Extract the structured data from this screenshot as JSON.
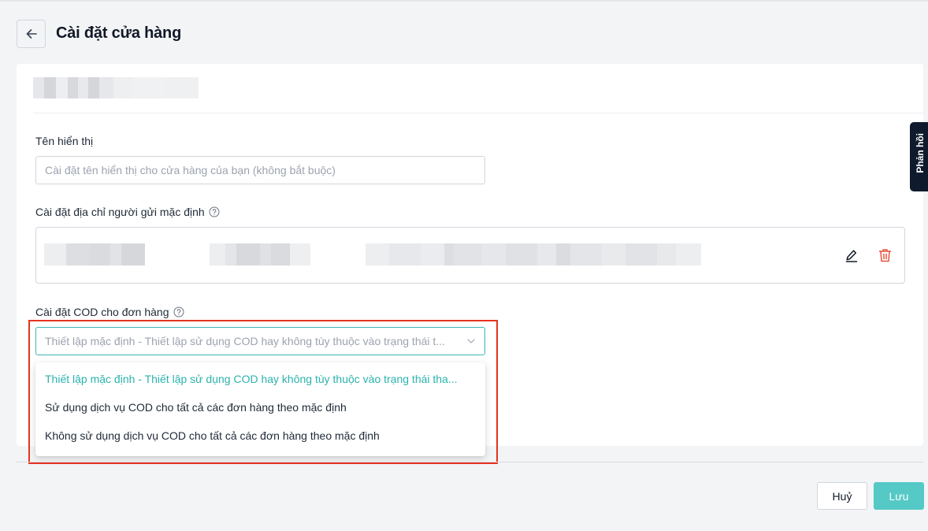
{
  "header": {
    "title": "Cài đặt cửa hàng",
    "back_icon": "arrow-left-icon"
  },
  "form": {
    "display_name": {
      "label": "Tên hiển thị",
      "placeholder": "Cài đặt tên hiển thị cho cửa hàng của bạn (không bắt buộc)",
      "value": ""
    },
    "sender_address": {
      "label": "Cài đặt địa chỉ người gửi mặc định",
      "help_icon": "question-circle-icon",
      "edit_icon": "pencil-icon",
      "delete_icon": "trash-icon"
    },
    "cod": {
      "label": "Cài đặt COD cho đơn hàng",
      "help_icon": "question-circle-icon",
      "selected_value": "Thiết lập mặc định - Thiết lập sử dụng COD hay không tùy thuộc vào trạng thái t...",
      "chevron_icon": "chevron-down-icon",
      "options": [
        {
          "label": "Thiết lập mặc định - Thiết lập sử dụng COD hay không tùy thuộc vào trạng thái tha...",
          "selected": true
        },
        {
          "label": "Sử dụng dịch vụ COD cho tất cả các đơn hàng theo mặc định",
          "selected": false
        },
        {
          "label": "Không sử dụng dịch vụ COD cho tất cả các đơn hàng theo mặc định",
          "selected": false
        }
      ]
    }
  },
  "footer": {
    "cancel_label": "Huỷ",
    "save_label": "Lưu"
  },
  "feedback_tab": {
    "label": "Phản hồi"
  },
  "colors": {
    "accent": "#2ab3ad",
    "save_button": "#54c9c6",
    "delete_icon": "#e5533d",
    "highlight_border": "#e5331f",
    "feedback_tab": "#0f1b2d"
  }
}
